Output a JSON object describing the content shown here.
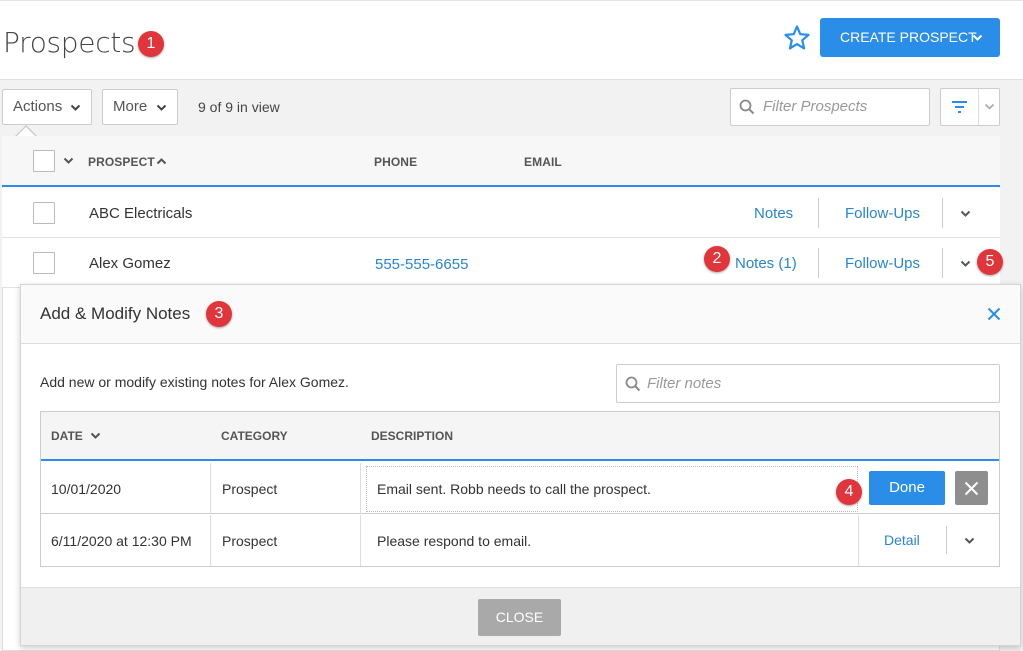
{
  "header": {
    "title": "Prospects",
    "create_label": "CREATE PROSPECT"
  },
  "toolbar": {
    "actions_label": "Actions",
    "more_label": "More",
    "in_view": "9 of 9 in view",
    "filter_placeholder": "Filter Prospects"
  },
  "table": {
    "columns": [
      "PROSPECT",
      "PHONE",
      "EMAIL"
    ],
    "rows": [
      {
        "name": "ABC Electricals",
        "phone": "",
        "notes": "Notes",
        "followups": "Follow-Ups"
      },
      {
        "name": "Alex Gomez",
        "phone": "555-555-6655",
        "notes": "Notes (1)",
        "followups": "Follow-Ups"
      }
    ]
  },
  "modal": {
    "title": "Add & Modify Notes",
    "description": "Add new or modify existing notes for Alex Gomez.",
    "filter_placeholder": "Filter notes",
    "columns": [
      "DATE",
      "CATEGORY",
      "DESCRIPTION"
    ],
    "notes": [
      {
        "date": "10/01/2020",
        "category": "Prospect",
        "description": "Email sent. Robb needs to call the prospect.",
        "done": "Done"
      },
      {
        "date": "6/11/2020 at 12:30 PM",
        "category": "Prospect",
        "description": "Please respond to email.",
        "detail": "Detail"
      }
    ],
    "close_label": "CLOSE"
  },
  "annotations": [
    "1",
    "2",
    "3",
    "4",
    "5"
  ],
  "colors": {
    "accent": "#2a8ee8",
    "badge": "#e0353b",
    "link": "#2a85cf"
  }
}
